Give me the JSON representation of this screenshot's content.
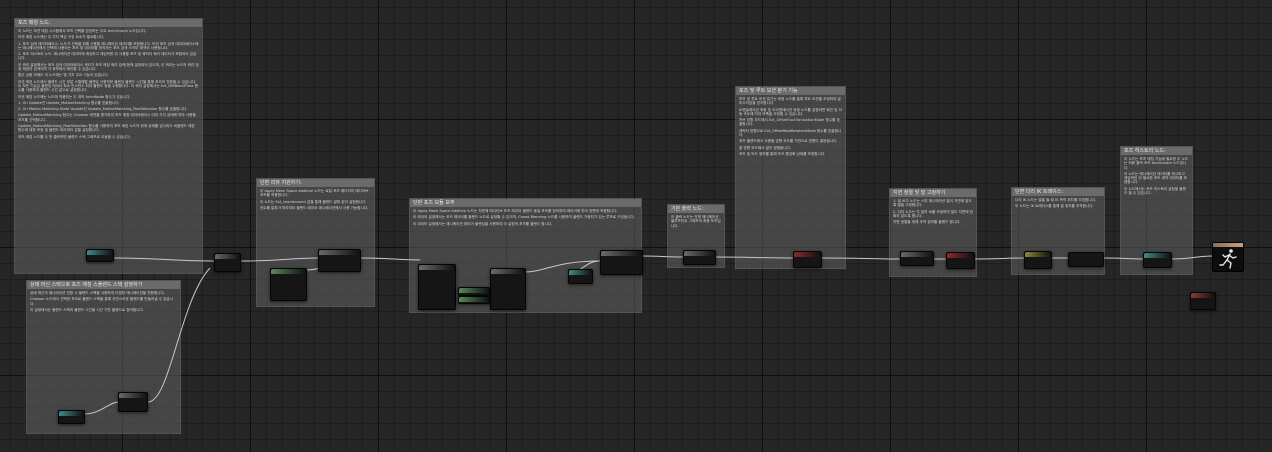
{
  "comments": {
    "c1": {
      "title": "포즈 매칭 노드:",
      "body": [
        "이 노드는 모션 매칭 시스템에서 포즈 선택을 담당하는 주요 AnimGraph 노드입니다.",
        "모션 매칭 노드에는 두 가지 핵심 구성 요소가 필요합니다.",
        "1. 포즈 검색 데이터베이스: 노드가 선택을 위해 사용할 애니메이션 데이터를 포함합니다. 모션 포즈 검색 데이터베이스에는 애니메이션에서 선택해 사용되는 포즈 및 데이터를 정의하는 포즈 검색 스키마 에셋이 사용됩니다.",
        "2. 포즈 히스토리 노드: 애니메이션 데이터에 캐싱하고 재입력한 뒤 사용할 포즈 및 궤적이 쿼리 데이터가 포함되어 있습니다.",
        "이 쿼리 살정에서는 포즈 검색 데이터베이스 쿼리가 포즈 매칭 쿼리 입력(현재 살정되어 있으며, 이 쿼리는 노드의 쿼리 범위 매칭의 검색이며 각 후보에서 확인할 수 있습니다.",
        "활주 상황 외에도 이 노드에는 몇 가지 주요 기능이 있습니다.",
        "모션 매칭 노드에서 블렌드 시간 부분 스켈레탈 블렌딩 사용자와 블렌딩 블렌드 시간을 통해 포즈의 전환을 수 있습니다. 이 모든 기능은 블렌딩 테이터 최소 인스턴스 최대 블렌드 등을 수행합니다. 이 쿼리 살정에서는 Ext_MMBlendTime 함수를 사용하여 블렌드 시간 값으로 살정합니다.",
        "모션 매칭 노드에는 노드에 적용되는 두 개의 AnimNode 함수가 있습니다.",
        "1. On Update인 Update_MotionMatching 함수를 호출합니다.",
        "2. On Motion Matching State Update인 Update_MotionMatching_PostSelection 함수를 호출합니다.",
        "Update_MotionMatching 함수는 Chooser 에셋을 평가하여 포즈 매칭 데이터베이스 여러 가지 상태에 따라 사용할 포즈를 선택합니다.",
        "Update_MotionMatching_PostSelection 함수를 사용하여 포즈 매칭 노드의 현재 상태를 검사하고 비블렌드 매칭 함수에 대한 보정 및 블렌드 파라미터 값을 살정합니다.",
        "포즈 매칭 노드를 두 번 클릭하면 블렌드 스택 그래프로 이동할 수 있습니다."
      ]
    },
    "c2": {
      "title": "상태 머신 스택으로 포즈 매칭 스플렌드 스택 살정하기",
      "body": [
        "상태 머신의 애니메이션 전환 시 블렌드 스택을 사용하여 다양한 애니메이션을 전환합니다.",
        "Chooser 노드에서 선택한 포즈로 블렌드 스택을 통해 자연스러운 블렌드를 만들어낼 수 있습니다.",
        "이 살정에서는 블렌드 스택의 블렌드 시간을 시간 기반 블렌드로 정의합니다."
      ]
    },
    "c3": {
      "title": "단편 리뷰 지원하기:",
      "body": [
        "이 Apply Mesh Space Additive 노드는 로컬 포즈 에디터의 애디티브 포즈를 적용합니다.",
        "이 노드는 Ext_LeanAmount 값을 통해 블렌드 알파 값이 살정됩니다.",
        "컨트롤 알파가 파라미터 블렌드 레이어 애니메이션에서 사용 가능합니다."
      ]
    },
    "c4": {
      "title": "단판 포즈 모듈 보주",
      "body": [
        "이 Apply Mesh Space Additive 노드는 지면에 애디티브 포즈 레이어 블렌드 동일 포즈를 정의하여 레이어에 따라 장면에 적용합니다.",
        "이 레이어 살정에서는 포즈 레이어를 블렌드 노드로 살정할 수 있으며, Crowd Blending 노드를 사용하여 블렌드 가중치가 있는 루프로 구성됩니다.",
        "이 데이터 살정에서는 애니메이션 레이어 블렌딩을 사용하여 이 살정의 포즈를 블렌드 합니다."
      ]
    },
    "c5": {
      "title": "기본 출력 노드:",
      "body": [
        "이 출력 노드는 전체 애니메이션 블루프린트 그래프의 최종 포즈입니다."
      ]
    },
    "c6": {
      "title": "포즈 및 루트 모션 분기 기능",
      "body": [
        "포즈 및 루트 모션 분기는 워핑 노드를 통해 루트 모션을 조정하여 발 미끄러짐을 방지합니다.",
        "트랜슬레이션 워핑 및 오리엔테이션 워핑 노드를 살정하면 회전 및 이동 속도에 따라 보폭을 조정할 수 있습니다.",
        "커브 방향 모드에서 Ext_OffsetFootTranslationMode 함수를 호출합니다.",
        "캐릭터 방향으로 Ext_OffsetRootRotationMode 함수를 호출합니다.",
        "포즈 블렌드에서 사용될 방향 속도를 기반으로 방향이 결정됩니다.",
        "발 방향 모드에서 발이 정렬됩니다.",
        "포즈 및 모드 정보를 통해 포즈 활성화 상태를 보정합니다."
      ]
    },
    "c7": {
      "title": "지면 정렬 및 발 고정하기",
      "body": [
        "1. 발 IK가 노드는 스피 애니메이션 발이 지면에 닿도록 발을 고정합니다.",
        "2. 다리 노드는 각 발의 IK를 조정하여 발이 지면에 정확히 닿도록 합니다.",
        "지면 정렬을 위해 추적 정보를 블렌드 합니다."
      ]
    },
    "c8": {
      "title": "단면 다리 IK 트레이스:",
      "body": [
        "다리 IK 노드는 발을 들 때 IK 목적 위치를 조정합니다.",
        "이 노드는 IK 트레이스를 통해 발 위치를 추적합니다."
      ]
    },
    "c9": {
      "title": "포즈 히스토리 노드:",
      "body": [
        "이 노드는 포즈 매칭 기능에 필요한 이 노드는 최종 출력 포즈 AnimGraph 노드입니다.",
        "이 노드는 애니메이션 데이터를 캐시하고 재입력된 뒤 필요한 포즈 궤적 데이터를 포함합니다.",
        "이 노드에서는 포즈 히스토리 살정을 블렌드 할 수 있습니다."
      ]
    }
  },
  "nodes": [
    {
      "name": "graph-node",
      "title_color": "#3f8a8a"
    },
    {
      "name": "graph-node",
      "title_color": "#6a6a6a"
    },
    {
      "name": "graph-node",
      "title_color": "#5a8a5a"
    },
    {
      "name": "graph-node",
      "title_color": "#6a6a6a"
    },
    {
      "name": "graph-node",
      "title_color": "#3f8a8a"
    },
    {
      "name": "graph-node",
      "title_color": "#6a6a6a"
    },
    {
      "name": "graph-node",
      "title_color": "#6a6a6a"
    },
    {
      "name": "graph-node",
      "title_color": "#5a8a5a"
    },
    {
      "name": "graph-node",
      "title_color": "#5a8a5a"
    },
    {
      "name": "graph-node",
      "title_color": "#3f8a8a"
    },
    {
      "name": "graph-node",
      "title_color": "#6a6a6a"
    },
    {
      "name": "graph-node",
      "title_color": "#6a6a6a"
    },
    {
      "name": "graph-node",
      "title_color": "#8a2a2a"
    },
    {
      "name": "graph-node",
      "title_color": "#6a6a6a"
    },
    {
      "name": "graph-node",
      "title_color": "#8a2a2a"
    },
    {
      "name": "graph-node",
      "title_color": "#8a8a3a"
    },
    {
      "name": "graph-node",
      "title_color": "#6a6a6a"
    },
    {
      "name": "graph-node",
      "title_color": "#3f8a8a"
    },
    {
      "name": "graph-node",
      "title_color": "#8a3a3a"
    }
  ],
  "output_node": {
    "icon": "running-figure-icon"
  }
}
